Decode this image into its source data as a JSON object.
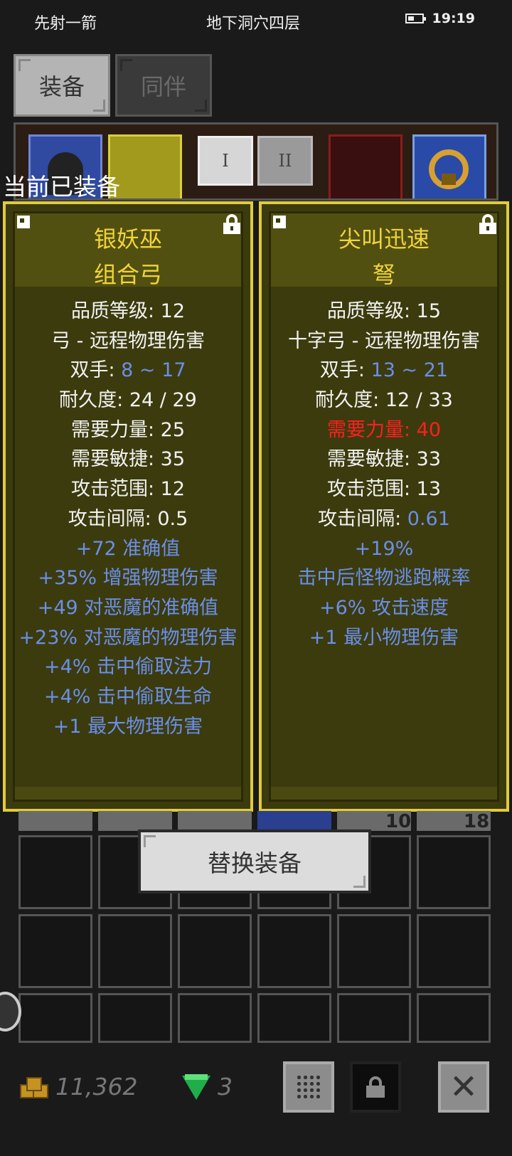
{
  "status_bar": {
    "left_text": "先射一箭",
    "center_text": "地下洞穴四层",
    "time": "19:19",
    "battery_icon": "battery-icon"
  },
  "tabs": [
    {
      "label": "装备",
      "active": true
    },
    {
      "label": "同伴",
      "active": false
    }
  ],
  "weapon_sets": [
    "I",
    "II"
  ],
  "equipped_title": "当前已装备",
  "cards": [
    {
      "name_line1": "银妖巫",
      "name_line2": "组合弓",
      "stats": [
        {
          "text": "品质等级: 12",
          "style": "normal"
        },
        {
          "text": "弓 - 远程物理伤害",
          "style": "normal"
        },
        {
          "label": "双手: ",
          "value": "8 ~ 17",
          "style": "labeled"
        },
        {
          "text": "耐久度: 24 / 29",
          "style": "normal"
        },
        {
          "text": "需要力量: 25",
          "style": "normal"
        },
        {
          "text": "需要敏捷: 35",
          "style": "normal"
        },
        {
          "text": "攻击范围: 12",
          "style": "normal"
        },
        {
          "text": "攻击间隔: 0.5",
          "style": "normal"
        },
        {
          "text": "+72 准确值",
          "style": "blue"
        },
        {
          "text": "+35% 增强物理伤害",
          "style": "blue"
        },
        {
          "text": "+49 对恶魔的准确值",
          "style": "blue"
        },
        {
          "text": "+23% 对恶魔的物理伤害",
          "style": "blue"
        },
        {
          "text": "+4% 击中偷取法力",
          "style": "blue"
        },
        {
          "text": "+4% 击中偷取生命",
          "style": "blue"
        },
        {
          "text": "+1 最大物理伤害",
          "style": "blue"
        }
      ]
    },
    {
      "name_line1": "尖叫迅速",
      "name_line2": "弩",
      "stats": [
        {
          "text": "品质等级: 15",
          "style": "normal"
        },
        {
          "text": "十字弓 - 远程物理伤害",
          "style": "normal"
        },
        {
          "label": "双手: ",
          "value": "13 ~ 21",
          "style": "labeled"
        },
        {
          "text": "耐久度: 12 / 33",
          "style": "normal"
        },
        {
          "text": "需要力量: 40",
          "style": "red"
        },
        {
          "text": "需要敏捷: 33",
          "style": "normal"
        },
        {
          "text": "攻击范围: 13",
          "style": "normal"
        },
        {
          "label": "攻击间隔: ",
          "value": "0.61",
          "style": "labeled"
        },
        {
          "text": "+19%",
          "style": "blue"
        },
        {
          "text": "击中后怪物逃跑概率",
          "style": "blue"
        },
        {
          "text": "+6% 攻击速度",
          "style": "blue"
        },
        {
          "text": "+1 最小物理伤害",
          "style": "blue"
        }
      ]
    }
  ],
  "inventory_counts": [
    "10",
    "18"
  ],
  "replace_button": "替换装备",
  "currency": {
    "gold": "11,362",
    "gems": "3"
  },
  "bottom_buttons": {
    "grid_icon": "grid-icon",
    "lock_icon": "lock-icon",
    "close_icon": "close-icon",
    "close_glyph": "✕"
  },
  "colors": {
    "card_border": "#e1cc3a",
    "item_name": "#f0d43a",
    "magic_stat": "#6a8fe8",
    "unmet_requirement": "#ff1f1f"
  }
}
